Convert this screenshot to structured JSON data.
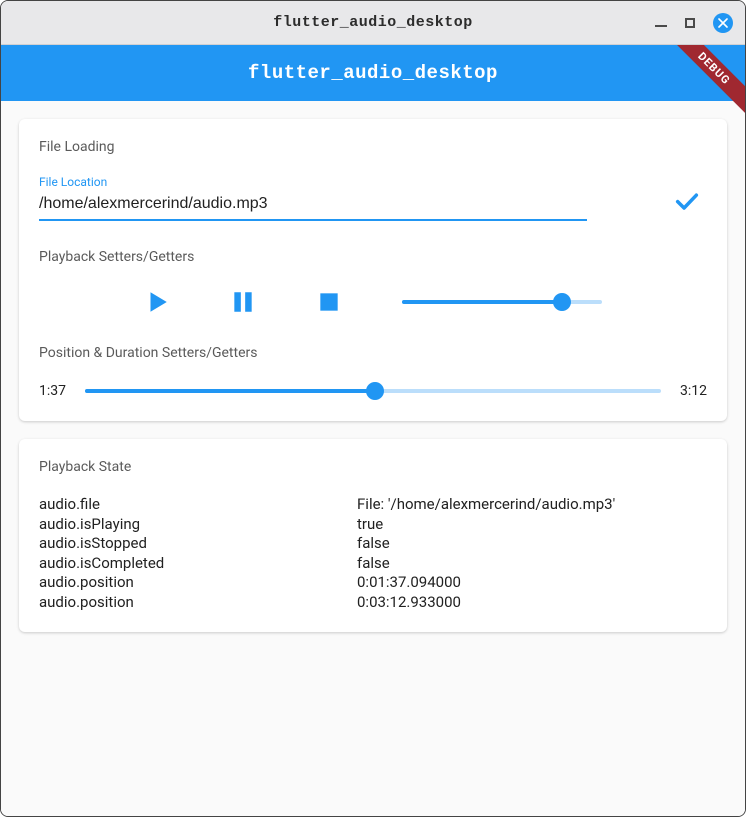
{
  "window": {
    "title": "flutter_audio_desktop"
  },
  "appbar": {
    "title": "flutter_audio_desktop"
  },
  "debug_banner": "DEBUG",
  "card1": {
    "fileLoadingLabel": "File Loading",
    "fileLocationLabel": "File Location",
    "fileLocationValue": "/home/alexmercerind/audio.mp3",
    "playbackSettersLabel": "Playback Setters/Getters",
    "positionDurationLabel": "Position & Duration Setters/Getters",
    "volumePercent": 80,
    "positionPercent": 50.4,
    "positionCurrent": "1:37",
    "positionTotal": "3:12"
  },
  "card2": {
    "stateLabel": "Playback State",
    "keys": [
      "audio.file",
      "audio.isPlaying",
      "audio.isStopped",
      "audio.isCompleted",
      "audio.position",
      "audio.position"
    ],
    "vals": [
      "File: '/home/alexmercerind/audio.mp3'",
      "true",
      "false",
      "false",
      "0:01:37.094000",
      "0:03:12.933000"
    ]
  },
  "colors": {
    "primary": "#2196F3"
  }
}
